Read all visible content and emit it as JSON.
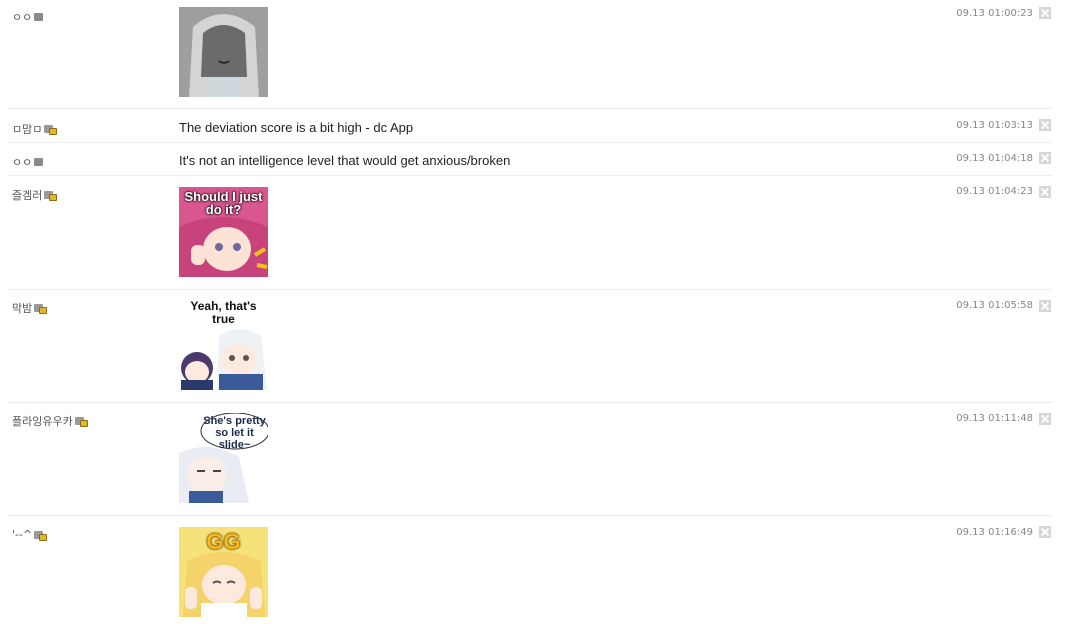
{
  "comments": [
    {
      "nick": "ㅇㅇ",
      "badge": "fixed",
      "time": "09.13 01:00:23",
      "type": "sticker",
      "sticker_icon": "gray-hooded-girl-sticker",
      "sticker_text": ""
    },
    {
      "nick": "ㅁ맘ㅁ",
      "badge": "lock",
      "time": "09.13 01:03:13",
      "type": "text",
      "text": "The deviation score is a bit high - dc App"
    },
    {
      "nick": "ㅇㅇ",
      "badge": "fixed",
      "time": "09.13 01:04:18",
      "type": "text",
      "text": "It's not an intelligence level that would get anxious/broken"
    },
    {
      "nick": "즐겜러",
      "badge": "lock",
      "time": "09.13 01:04:23",
      "type": "sticker",
      "sticker_icon": "pink-hair-girl-sticker",
      "sticker_text": "Should I just do it?"
    },
    {
      "nick": "막밤",
      "badge": "lock",
      "time": "09.13 01:05:58",
      "type": "sticker",
      "sticker_icon": "white-hair-girls-sticker",
      "sticker_text": "Yeah, that's true"
    },
    {
      "nick": "플라잉유우카",
      "badge": "lock",
      "time": "09.13 01:11:48",
      "type": "sticker",
      "sticker_icon": "white-hair-speech-bubble-sticker",
      "sticker_text": "She's pretty so let it slide~"
    },
    {
      "nick": "'--^",
      "badge": "lock",
      "time": "09.13 01:16:49",
      "type": "sticker",
      "sticker_icon": "blonde-girl-gg-sticker",
      "sticker_text": "GG"
    }
  ],
  "colors": {
    "divider": "#ececec",
    "time": "#888888",
    "delete": "#d6d6d6"
  }
}
